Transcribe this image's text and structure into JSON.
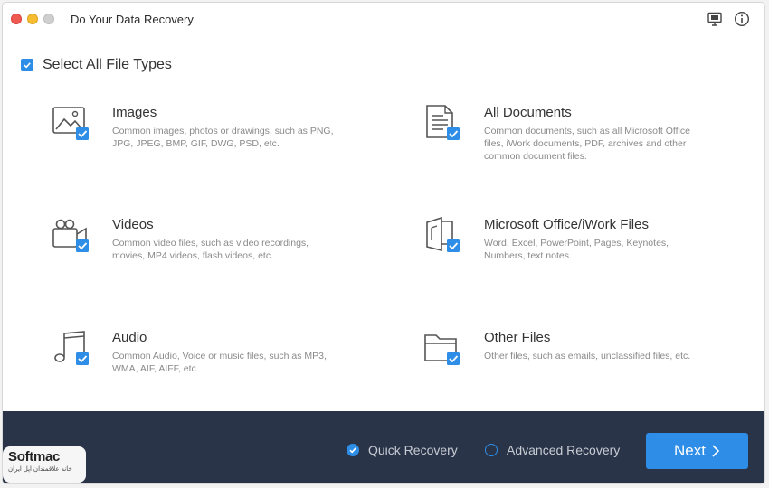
{
  "window": {
    "title": "Do Your Data Recovery"
  },
  "select_all": {
    "label": "Select All File Types",
    "checked": true
  },
  "file_types": [
    {
      "key": "images",
      "title": "Images",
      "description": "Common images, photos or drawings, such as PNG, JPG, JPEG, BMP, GIF, DWG, PSD, etc.",
      "icon": "image-icon",
      "checked": true
    },
    {
      "key": "documents",
      "title": "All Documents",
      "description": "Common documents, such as all Microsoft Office files, iWork documents, PDF, archives and other common document files.",
      "icon": "document-icon",
      "checked": true
    },
    {
      "key": "videos",
      "title": "Videos",
      "description": "Common video files, such as video recordings, movies, MP4 videos, flash videos, etc.",
      "icon": "video-camera-icon",
      "checked": true
    },
    {
      "key": "office",
      "title": "Microsoft Office/iWork Files",
      "description": "Word, Excel, PowerPoint, Pages, Keynotes, Numbers, text notes.",
      "icon": "office-icon",
      "checked": true
    },
    {
      "key": "audio",
      "title": "Audio",
      "description": "Common Audio, Voice or music files, such as MP3, WMA, AIF, AIFF, etc.",
      "icon": "music-note-icon",
      "checked": true
    },
    {
      "key": "other",
      "title": "Other Files",
      "description": "Other files, such as emails, unclassified files, etc.",
      "icon": "folder-icon",
      "checked": true
    }
  ],
  "recovery_modes": {
    "quick": {
      "label": "Quick Recovery",
      "selected": true
    },
    "advanced": {
      "label": "Advanced Recovery",
      "selected": false
    }
  },
  "next_button": {
    "label": "Next"
  },
  "watermark": {
    "logo": "Softmac",
    "subtitle": "خانه علاقمندان اپل ایران"
  },
  "colors": {
    "accent": "#2e8de6",
    "bottom_bar": "#2a3448",
    "text": "#333333",
    "muted": "#8a8a8a"
  }
}
